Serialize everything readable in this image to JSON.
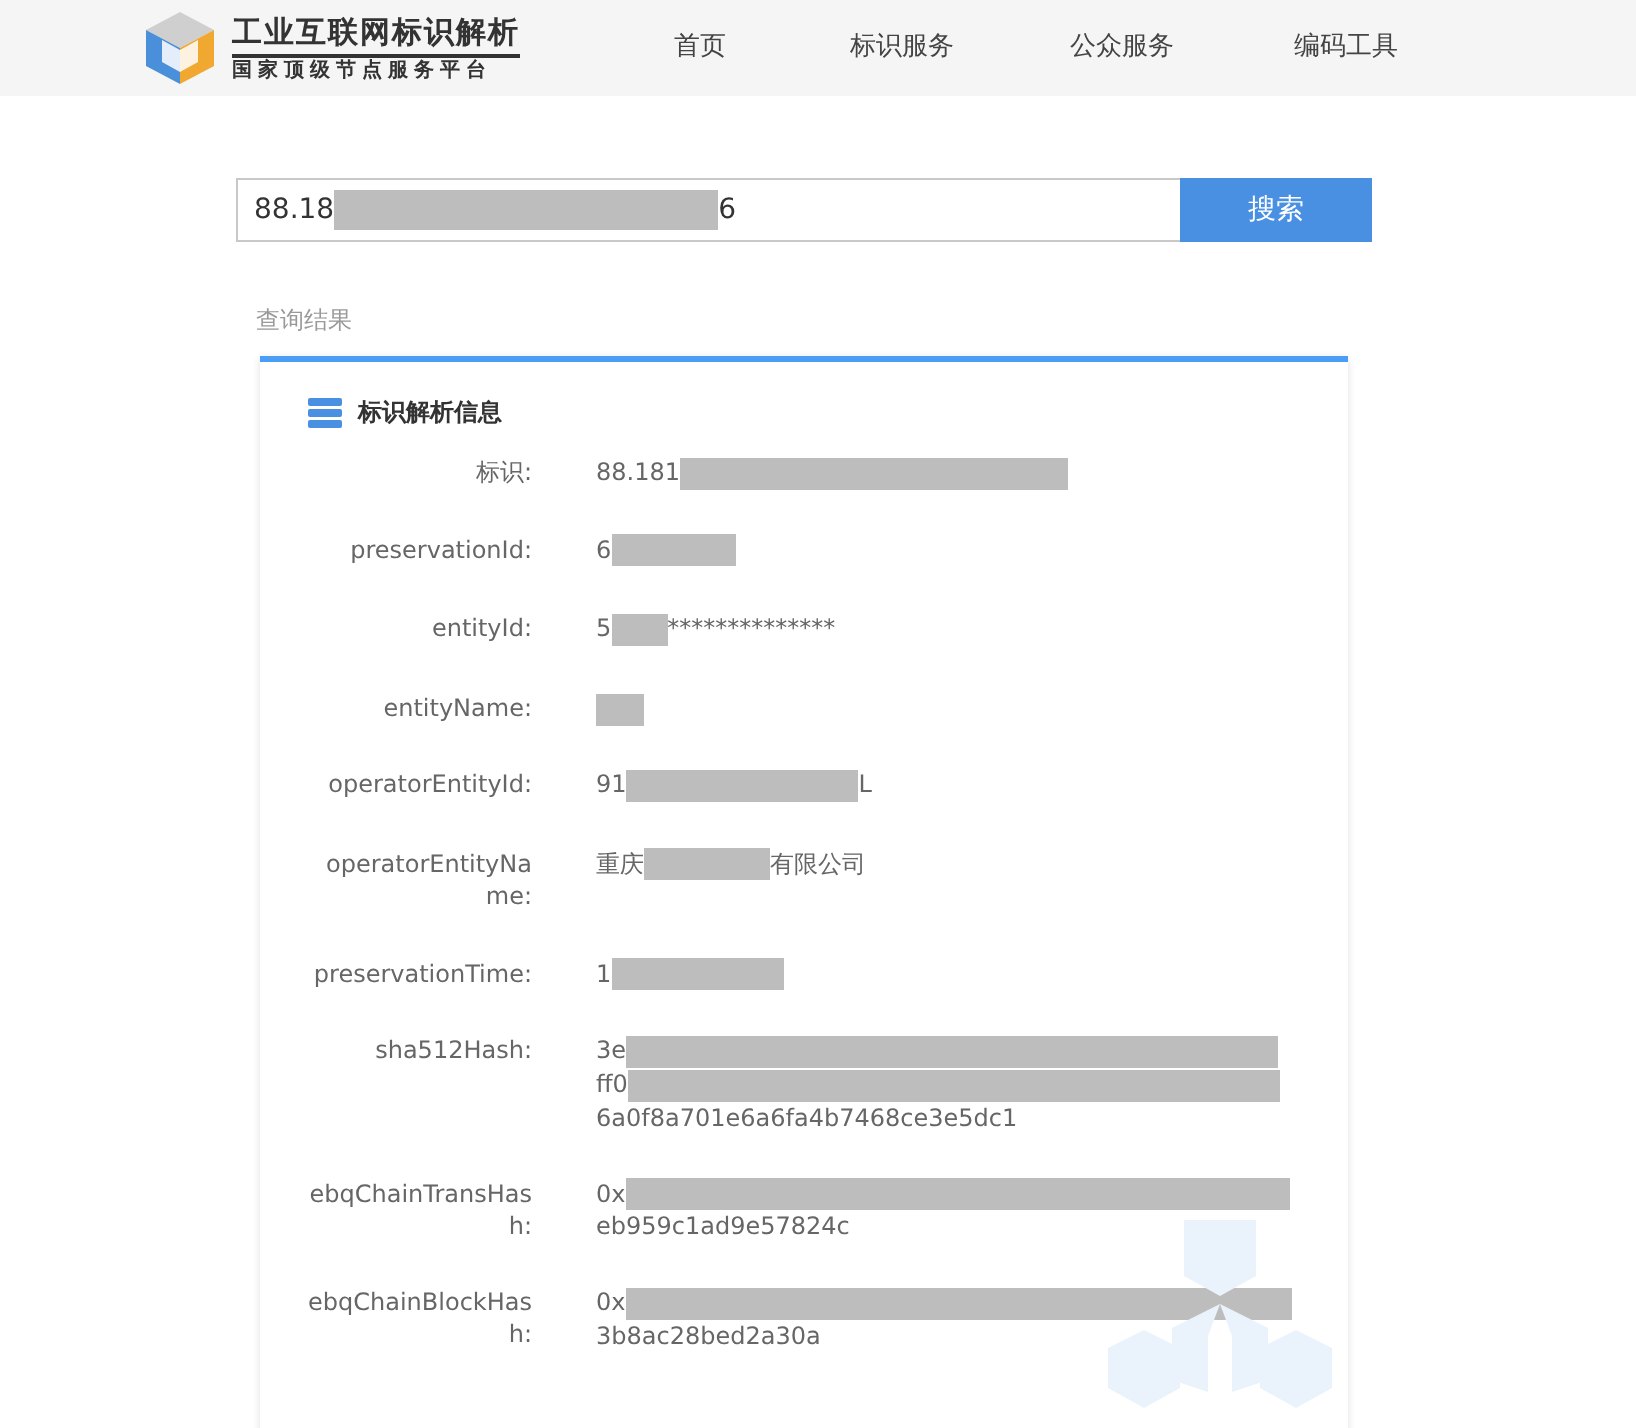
{
  "header": {
    "logo_title": "工业互联网标识解析",
    "logo_subtitle": "国家顶级节点服务平台",
    "nav": [
      {
        "label": "首页"
      },
      {
        "label": "标识服务"
      },
      {
        "label": "公众服务"
      },
      {
        "label": "编码工具"
      }
    ]
  },
  "search": {
    "value": [
      {
        "kind": "text",
        "text": "88.18"
      },
      {
        "kind": "redaction"
      },
      {
        "kind": "text",
        "text": "6"
      }
    ],
    "button": "搜索"
  },
  "results_label": "查询结果",
  "card": {
    "title": "标识解析信息",
    "fields": [
      {
        "label": "标识:",
        "lines": [
          [
            {
              "kind": "text",
              "text": "88.181"
            },
            {
              "kind": "redaction"
            }
          ]
        ]
      },
      {
        "label": "preservationId:",
        "lines": [
          [
            {
              "kind": "text",
              "text": "6"
            },
            {
              "kind": "redaction"
            }
          ]
        ]
      },
      {
        "label": "entityId:",
        "lines": [
          [
            {
              "kind": "text",
              "text": "5"
            },
            {
              "kind": "redaction"
            },
            {
              "kind": "text",
              "text": "**************"
            }
          ]
        ]
      },
      {
        "label": "entityName:",
        "lines": [
          [
            {
              "kind": "redaction"
            }
          ]
        ]
      },
      {
        "label": "operatorEntityId:",
        "lines": [
          [
            {
              "kind": "text",
              "text": "91"
            },
            {
              "kind": "redaction"
            },
            {
              "kind": "text",
              "text": "L"
            }
          ]
        ]
      },
      {
        "label": "operatorEntityName:",
        "lines": [
          [
            {
              "kind": "text",
              "text": "重庆"
            },
            {
              "kind": "redaction"
            },
            {
              "kind": "text",
              "text": "有限公司"
            }
          ]
        ]
      },
      {
        "label": "preservationTime:",
        "lines": [
          [
            {
              "kind": "text",
              "text": "1"
            },
            {
              "kind": "redaction"
            }
          ]
        ]
      },
      {
        "label": "sha512Hash:",
        "lines": [
          [
            {
              "kind": "text",
              "text": "3e"
            },
            {
              "kind": "redaction"
            }
          ],
          [
            {
              "kind": "text",
              "text": "ff0"
            },
            {
              "kind": "redaction"
            }
          ],
          [
            {
              "kind": "text",
              "text": "6a0f8a701e6a6fa4b7468ce3e5dc1"
            }
          ]
        ]
      },
      {
        "label": "ebqChainTransHash:",
        "lines": [
          [
            {
              "kind": "text",
              "text": "0x"
            },
            {
              "kind": "redaction"
            }
          ],
          [
            {
              "kind": "text",
              "text": "eb959c1ad9e57824c"
            }
          ]
        ]
      },
      {
        "label": "ebqChainBlockHash:",
        "lines": [
          [
            {
              "kind": "text",
              "text": "0x"
            },
            {
              "kind": "redaction"
            }
          ],
          [
            {
              "kind": "text",
              "text": "3b8ac28bed2a30a"
            }
          ]
        ]
      }
    ]
  }
}
